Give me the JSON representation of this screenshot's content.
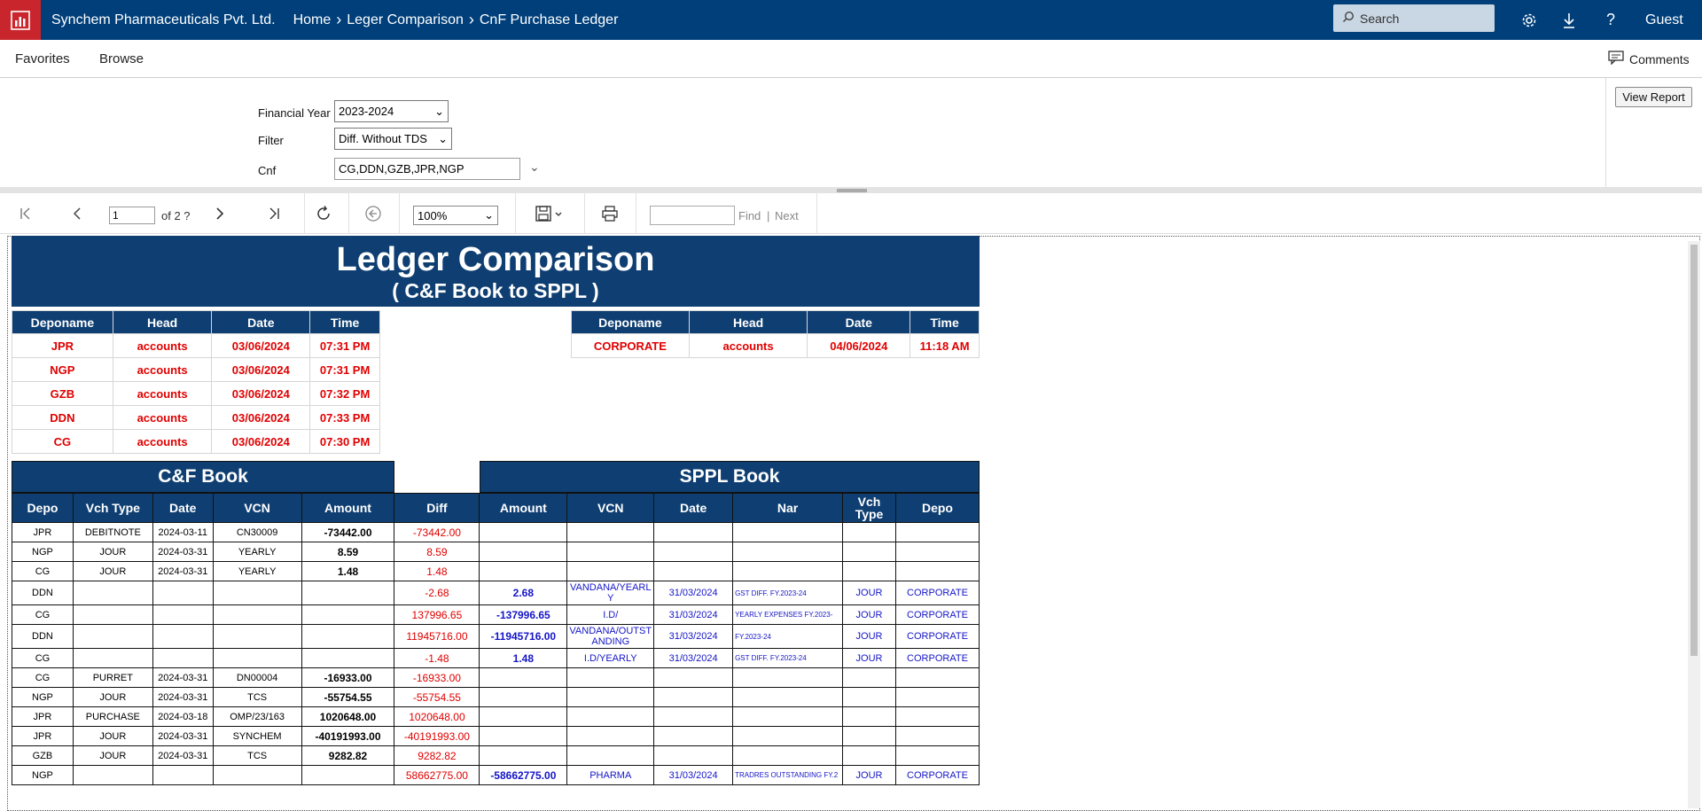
{
  "topbar": {
    "company": "Synchem Pharmaceuticals Pvt. Ltd.",
    "breadcrumbs": [
      "Home",
      "Leger Comparison",
      "CnF Purchase Ledger"
    ],
    "search_placeholder": "Search",
    "user": "Guest",
    "icons": [
      "report-logo-icon",
      "search-icon",
      "gear-icon",
      "download-icon",
      "help-icon"
    ]
  },
  "menubar": {
    "items": [
      "Favorites",
      "Browse"
    ],
    "comments_label": "Comments"
  },
  "params": {
    "financial_year_label": "Financial Year",
    "financial_year_value": "2023-2024",
    "filter_label": "Filter",
    "filter_value": "Diff. Without TDS",
    "cnf_label": "Cnf",
    "cnf_value": "CG,DDN,GZB,JPR,NGP",
    "view_report_label": "View Report"
  },
  "toolbar": {
    "page_value": "1",
    "of_pages": "of 2 ?",
    "zoom_value": "100%",
    "find_label": "Find",
    "next_label": "Next",
    "pipe": "|"
  },
  "report": {
    "title": "Ledger Comparison",
    "subtitle": "( C&F Book to SPPL )",
    "left_dep_headers": [
      "Deponame",
      "Head",
      "Date",
      "Time"
    ],
    "left_dep_rows": [
      [
        "JPR",
        "accounts",
        "03/06/2024",
        "07:31 PM"
      ],
      [
        "NGP",
        "accounts",
        "03/06/2024",
        "07:31 PM"
      ],
      [
        "GZB",
        "accounts",
        "03/06/2024",
        "07:32 PM"
      ],
      [
        "DDN",
        "accounts",
        "03/06/2024",
        "07:33 PM"
      ],
      [
        "CG",
        "accounts",
        "03/06/2024",
        "07:30 PM"
      ]
    ],
    "right_dep_headers": [
      "Deponame",
      "Head",
      "Date",
      "Time"
    ],
    "right_dep_rows": [
      [
        "CORPORATE",
        "accounts",
        "04/06/2024",
        "11:18 AM"
      ]
    ],
    "cf_book_title": "C&F Book",
    "sppl_book_title": "SPPL Book",
    "main_headers": [
      "Depo",
      "Vch Type",
      "Date",
      "VCN",
      "Amount",
      "Diff",
      "Amount",
      "VCN",
      "Date",
      "Nar",
      "Vch Type",
      "Depo"
    ],
    "rows": [
      {
        "depo": "JPR",
        "vch": "DEBITNOTE",
        "date": "2024-03-11",
        "vcn": "CN30009",
        "amt": "-73442.00",
        "diff": "-73442.00",
        "s_amt": "",
        "s_vcn": "",
        "s_date": "",
        "nar": "",
        "s_vch": "",
        "s_depo": ""
      },
      {
        "depo": "NGP",
        "vch": "JOUR",
        "date": "2024-03-31",
        "vcn": "YEARLY",
        "amt": "8.59",
        "diff": "8.59",
        "s_amt": "",
        "s_vcn": "",
        "s_date": "",
        "nar": "",
        "s_vch": "",
        "s_depo": ""
      },
      {
        "depo": "CG",
        "vch": "JOUR",
        "date": "2024-03-31",
        "vcn": "YEARLY",
        "amt": "1.48",
        "diff": "1.48",
        "s_amt": "",
        "s_vcn": "",
        "s_date": "",
        "nar": "",
        "s_vch": "",
        "s_depo": ""
      },
      {
        "depo": "DDN",
        "vch": "",
        "date": "",
        "vcn": "",
        "amt": "",
        "diff": "-2.68",
        "s_amt": "2.68",
        "s_vcn": "VANDANA/YEARLY",
        "s_date": "31/03/2024",
        "nar": "GST DIFF. FY.2023-24",
        "s_vch": "JOUR",
        "s_depo": "CORPORATE"
      },
      {
        "depo": "CG",
        "vch": "",
        "date": "",
        "vcn": "",
        "amt": "",
        "diff": "137996.65",
        "s_amt": "-137996.65",
        "s_vcn": "I.D/",
        "s_date": "31/03/2024",
        "nar": "YEARLY EXPENSES FY.2023-",
        "s_vch": "JOUR",
        "s_depo": "CORPORATE"
      },
      {
        "depo": "DDN",
        "vch": "",
        "date": "",
        "vcn": "",
        "amt": "",
        "diff": "11945716.00",
        "s_amt": "-11945716.00",
        "s_vcn": "VANDANA/OUTSTANDING",
        "s_date": "31/03/2024",
        "nar": "FY.2023-24",
        "s_vch": "JOUR",
        "s_depo": "CORPORATE"
      },
      {
        "depo": "CG",
        "vch": "",
        "date": "",
        "vcn": "",
        "amt": "",
        "diff": "-1.48",
        "s_amt": "1.48",
        "s_vcn": "I.D/YEARLY",
        "s_date": "31/03/2024",
        "nar": "GST DIFF. FY.2023-24",
        "s_vch": "JOUR",
        "s_depo": "CORPORATE"
      },
      {
        "depo": "CG",
        "vch": "PURRET",
        "date": "2024-03-31",
        "vcn": "DN00004",
        "amt": "-16933.00",
        "diff": "-16933.00",
        "s_amt": "",
        "s_vcn": "",
        "s_date": "",
        "nar": "",
        "s_vch": "",
        "s_depo": ""
      },
      {
        "depo": "NGP",
        "vch": "JOUR",
        "date": "2024-03-31",
        "vcn": "TCS",
        "amt": "-55754.55",
        "diff": "-55754.55",
        "s_amt": "",
        "s_vcn": "",
        "s_date": "",
        "nar": "",
        "s_vch": "",
        "s_depo": ""
      },
      {
        "depo": "JPR",
        "vch": "PURCHASE",
        "date": "2024-03-18",
        "vcn": "OMP/23/163",
        "amt": "1020648.00",
        "diff": "1020648.00",
        "s_amt": "",
        "s_vcn": "",
        "s_date": "",
        "nar": "",
        "s_vch": "",
        "s_depo": ""
      },
      {
        "depo": "JPR",
        "vch": "JOUR",
        "date": "2024-03-31",
        "vcn": "SYNCHEM",
        "amt": "-40191993.00",
        "diff": "-40191993.00",
        "s_amt": "",
        "s_vcn": "",
        "s_date": "",
        "nar": "",
        "s_vch": "",
        "s_depo": ""
      },
      {
        "depo": "GZB",
        "vch": "JOUR",
        "date": "2024-03-31",
        "vcn": "TCS",
        "amt": "9282.82",
        "diff": "9282.82",
        "s_amt": "",
        "s_vcn": "",
        "s_date": "",
        "nar": "",
        "s_vch": "",
        "s_depo": ""
      },
      {
        "depo": "NGP",
        "vch": "",
        "date": "",
        "vcn": "",
        "amt": "",
        "diff": "58662775.00",
        "s_amt": "-58662775.00",
        "s_vcn": "PHARMA",
        "s_date": "31/03/2024",
        "nar": "TRADRES OUTSTANDING FY.2",
        "s_vch": "JOUR",
        "s_depo": "CORPORATE"
      }
    ]
  },
  "colors": {
    "topbar": "#003f7a",
    "logo": "#c9252c",
    "report_header": "#0f3f72",
    "red_text": "#e00000",
    "blue_text": "#1515c8"
  }
}
